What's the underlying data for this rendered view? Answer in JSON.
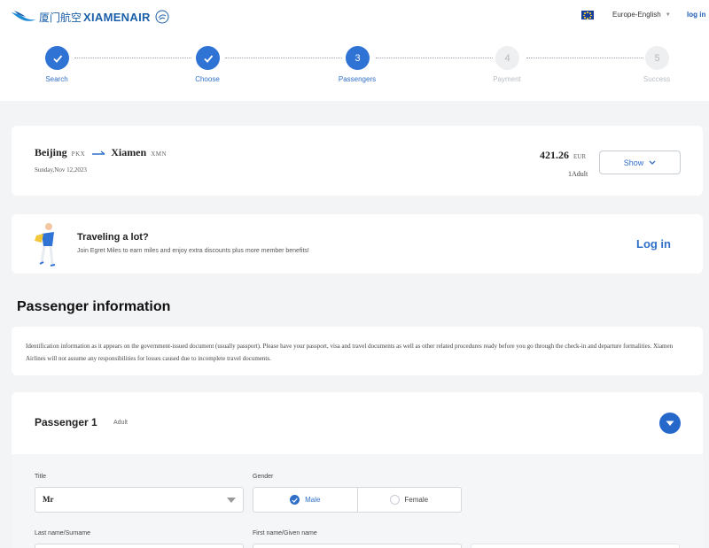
{
  "brand": {
    "cn": "厦门航空",
    "en": "XIAMENAIR"
  },
  "header": {
    "language": "Europe-English",
    "login": "log in"
  },
  "steps": [
    {
      "label": "Search",
      "num": "1",
      "state": "done"
    },
    {
      "label": "Choose",
      "num": "2",
      "state": "done"
    },
    {
      "label": "Passengers",
      "num": "3",
      "state": "current"
    },
    {
      "label": "Payment",
      "num": "4",
      "state": "todo"
    },
    {
      "label": "Success",
      "num": "5",
      "state": "todo"
    }
  ],
  "flight": {
    "from_city": "Beijing",
    "from_code": "PKX",
    "to_city": "Xiamen",
    "to_code": "XMN",
    "date": "Sunday,Nov 12,2023",
    "price": "421.26",
    "currency": "EUR",
    "pax": "1Adult",
    "show_label": "Show"
  },
  "promo": {
    "title": "Traveling a lot?",
    "desc": "Join Egret Miles to earn miles and enjoy extra discounts plus more member benefits!",
    "login": "Log in"
  },
  "section_title": "Passenger information",
  "notice": "Identification information as it appears on the government-issued document (usually passport). Please have your passport, visa and travel documents as well as other related procedures ready before you go through the check-in and departure formalities. Xiamen Airlines will not assume any responsibilities for losses caused due to incomplete travel documents.",
  "passenger": {
    "title": "Passenger 1",
    "type": "Adult",
    "fields": {
      "title_label": "Title",
      "title_value": "Mr",
      "gender_label": "Gender",
      "male": "Male",
      "female": "Female",
      "last_name_label": "Last name/Surname",
      "first_name_label": "First name/Given name"
    }
  },
  "colors": {
    "primary": "#2f73d4",
    "brand": "#1b5fa8"
  }
}
